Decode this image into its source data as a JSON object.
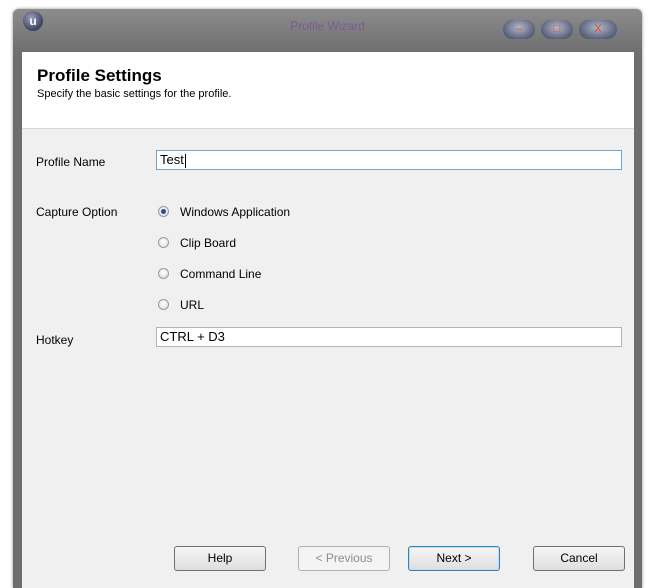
{
  "window": {
    "title": "Profile Wizard",
    "app_icon_letter": "u",
    "minimize_glyph": "–",
    "maximize_glyph": "□",
    "close_glyph": "X"
  },
  "header": {
    "title": "Profile Settings",
    "subtitle": "Specify the basic settings for the profile."
  },
  "form": {
    "profile_name_label": "Profile Name",
    "profile_name_value": "Test",
    "capture_option_label": "Capture Option",
    "capture_options": [
      {
        "label": "Windows Application",
        "selected": true
      },
      {
        "label": "Clip Board",
        "selected": false
      },
      {
        "label": "Command Line",
        "selected": false
      },
      {
        "label": "URL",
        "selected": false
      }
    ],
    "hotkey_label": "Hotkey",
    "hotkey_value": "CTRL + D3"
  },
  "buttons": {
    "help": "Help",
    "previous": "< Previous",
    "next": "Next >",
    "cancel": "Cancel"
  },
  "colors": {
    "title_text": "#7a5a9c",
    "selected_radio": "#2a4f8c",
    "focus_border": "#6aa7d8"
  }
}
